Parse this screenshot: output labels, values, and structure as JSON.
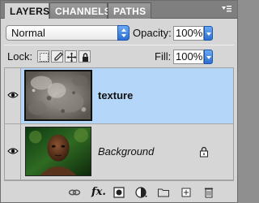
{
  "tabs": [
    {
      "label": "LAYERS",
      "active": true
    },
    {
      "label": "CHANNELS",
      "active": false
    },
    {
      "label": "PATHS",
      "active": false
    }
  ],
  "panel_menu_icon": "panel-menu-icon",
  "blend_mode": {
    "value": "Normal"
  },
  "opacity": {
    "label": "Opacity:",
    "value": "100%"
  },
  "lock": {
    "label": "Lock:",
    "icons": [
      "lock-transparent-icon",
      "lock-image-icon",
      "lock-position-icon",
      "lock-all-icon"
    ]
  },
  "fill": {
    "label": "Fill:",
    "value": "100%"
  },
  "layers": [
    {
      "name": "texture",
      "visible": true,
      "selected": true,
      "thumbnail": "stone-texture",
      "locked": false
    },
    {
      "name": "Background",
      "visible": true,
      "selected": false,
      "thumbnail": "portrait-photo",
      "locked": true
    }
  ],
  "bottom_icons": [
    "link-layers-icon",
    "fx-icon",
    "add-mask-icon",
    "adjustment-layer-icon",
    "new-group-icon",
    "new-layer-icon",
    "trash-icon"
  ],
  "bottom_fx_label": "fx.",
  "colors": {
    "selected_row": "#b4d6f8",
    "accent": "#2d6fd1",
    "panel": "#d6d6d6"
  }
}
